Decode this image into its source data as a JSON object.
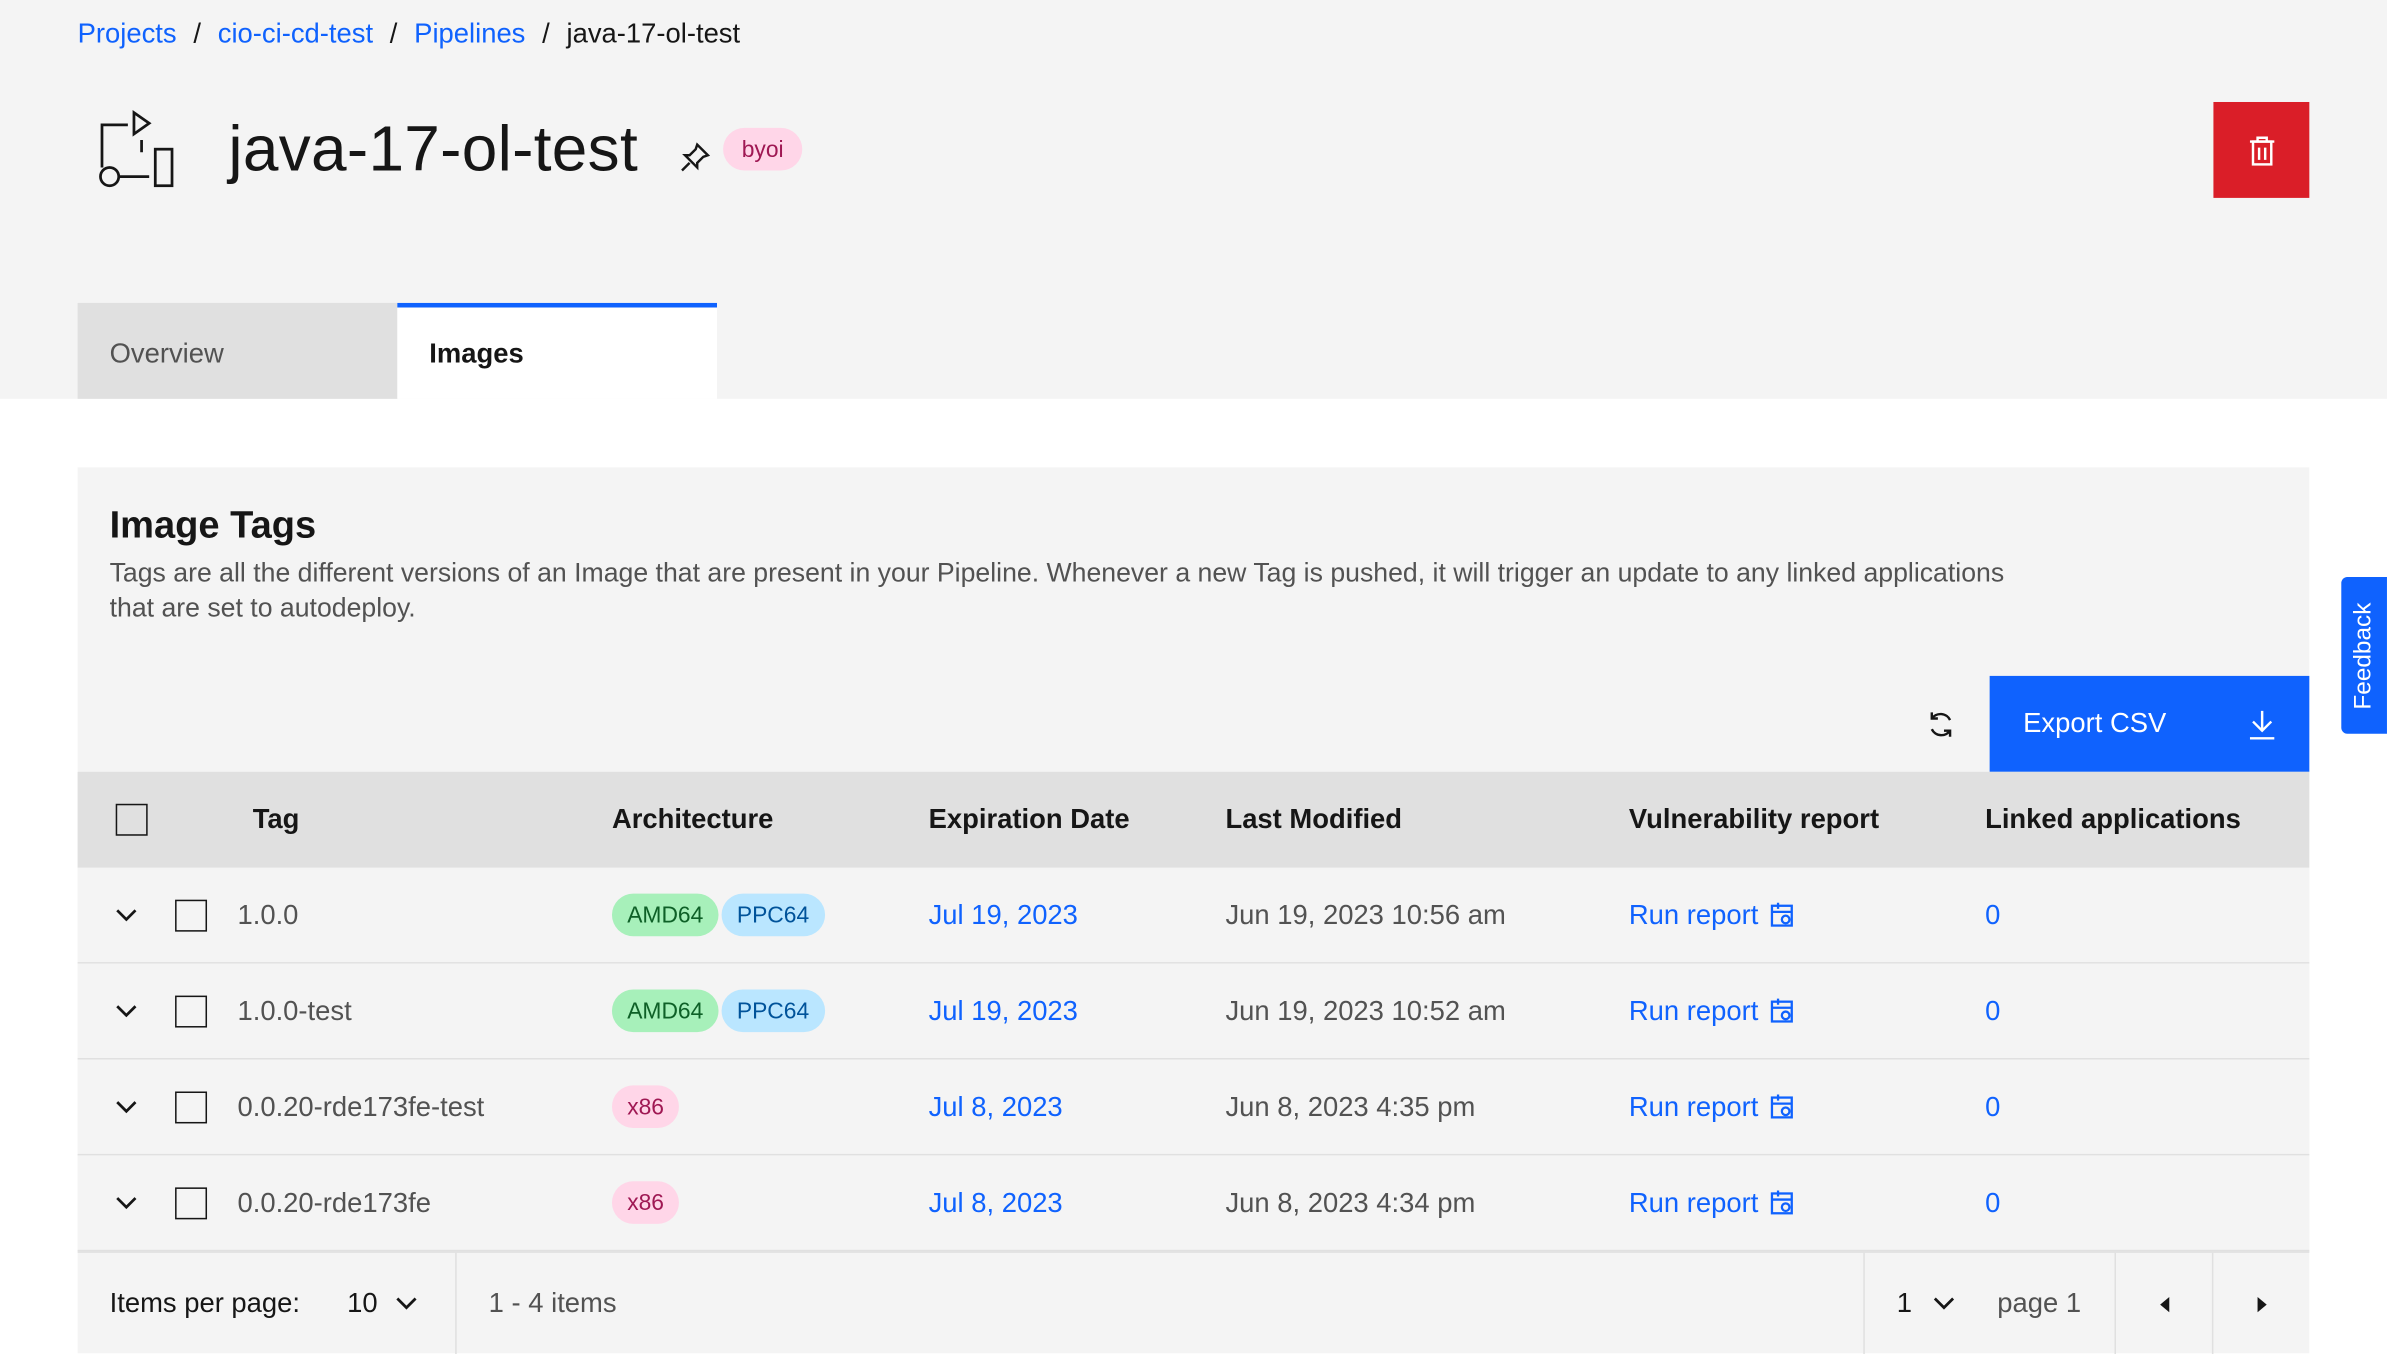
{
  "breadcrumb": {
    "items": [
      "Projects",
      "cio-ci-cd-test",
      "Pipelines"
    ],
    "current": "java-17-ol-test",
    "separator": "/"
  },
  "header": {
    "title": "java-17-ol-test",
    "badge": "byoi",
    "icons": [
      "pipeline-icon",
      "pin-icon",
      "trash-icon"
    ]
  },
  "tabs": [
    {
      "label": "Overview",
      "active": false
    },
    {
      "label": "Images",
      "active": true
    }
  ],
  "card": {
    "title": "Image Tags",
    "description": "Tags are all the different versions of an Image that are present in your Pipeline. Whenever a new Tag is pushed, it will trigger an update to any linked applications that are set to autodeploy."
  },
  "toolbar": {
    "export_label": "Export CSV"
  },
  "table": {
    "headers": {
      "tag": "Tag",
      "architecture": "Architecture",
      "expiration": "Expiration Date",
      "modified": "Last Modified",
      "vulnerability": "Vulnerability report",
      "linked": "Linked applications"
    },
    "rows": [
      {
        "tag": "1.0.0",
        "arch": [
          "AMD64",
          "PPC64"
        ],
        "expiration": "Jul 19, 2023",
        "modified": "Jun 19, 2023 10:56 am",
        "report": "Run report",
        "linked": "0"
      },
      {
        "tag": "1.0.0-test",
        "arch": [
          "AMD64",
          "PPC64"
        ],
        "expiration": "Jul 19, 2023",
        "modified": "Jun 19, 2023 10:52 am",
        "report": "Run report",
        "linked": "0"
      },
      {
        "tag": "0.0.20-rde173fe-test",
        "arch": [
          "x86"
        ],
        "expiration": "Jul 8, 2023",
        "modified": "Jun 8, 2023 4:35 pm",
        "report": "Run report",
        "linked": "0"
      },
      {
        "tag": "0.0.20-rde173fe",
        "arch": [
          "x86"
        ],
        "expiration": "Jul 8, 2023",
        "modified": "Jun 8, 2023 4:34 pm",
        "report": "Run report",
        "linked": "0"
      }
    ]
  },
  "pagination": {
    "items_per_page_label": "Items per page:",
    "items_per_page": "10",
    "range": "1 - 4 items",
    "page": "1",
    "page_label": "page 1"
  },
  "feedback": {
    "label": "Feedback"
  },
  "colors": {
    "accent": "#0f62fe",
    "danger": "#da1e28",
    "amd64": "#a7f0ba",
    "ppc64": "#bae6ff",
    "x86": "#ffd6e8"
  }
}
